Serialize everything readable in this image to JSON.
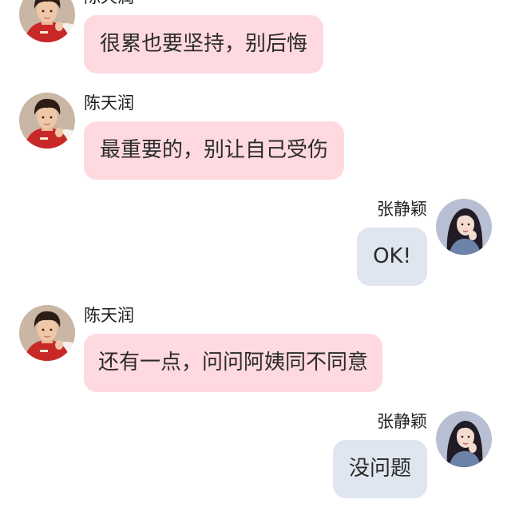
{
  "messages": [
    {
      "side": "left",
      "sender": "陈天润",
      "text": "很累也要坚持，别后悔",
      "avatar_icon": "boy-avatar",
      "bubble_color": "#ffd9e0"
    },
    {
      "side": "left",
      "sender": "陈天润",
      "text": "最重要的，别让自己受伤",
      "avatar_icon": "boy-avatar",
      "bubble_color": "#ffd9e0"
    },
    {
      "side": "right",
      "sender": "张静颖",
      "text": "OK!",
      "avatar_icon": "girl-avatar",
      "bubble_color": "#dfe6ef"
    },
    {
      "side": "left",
      "sender": "陈天润",
      "text": "还有一点，问问阿姨同不同意",
      "avatar_icon": "boy-avatar",
      "bubble_color": "#ffd9e0"
    },
    {
      "side": "right",
      "sender": "张静颖",
      "text": "没问题",
      "avatar_icon": "girl-avatar",
      "bubble_color": "#dfe6ef"
    }
  ]
}
